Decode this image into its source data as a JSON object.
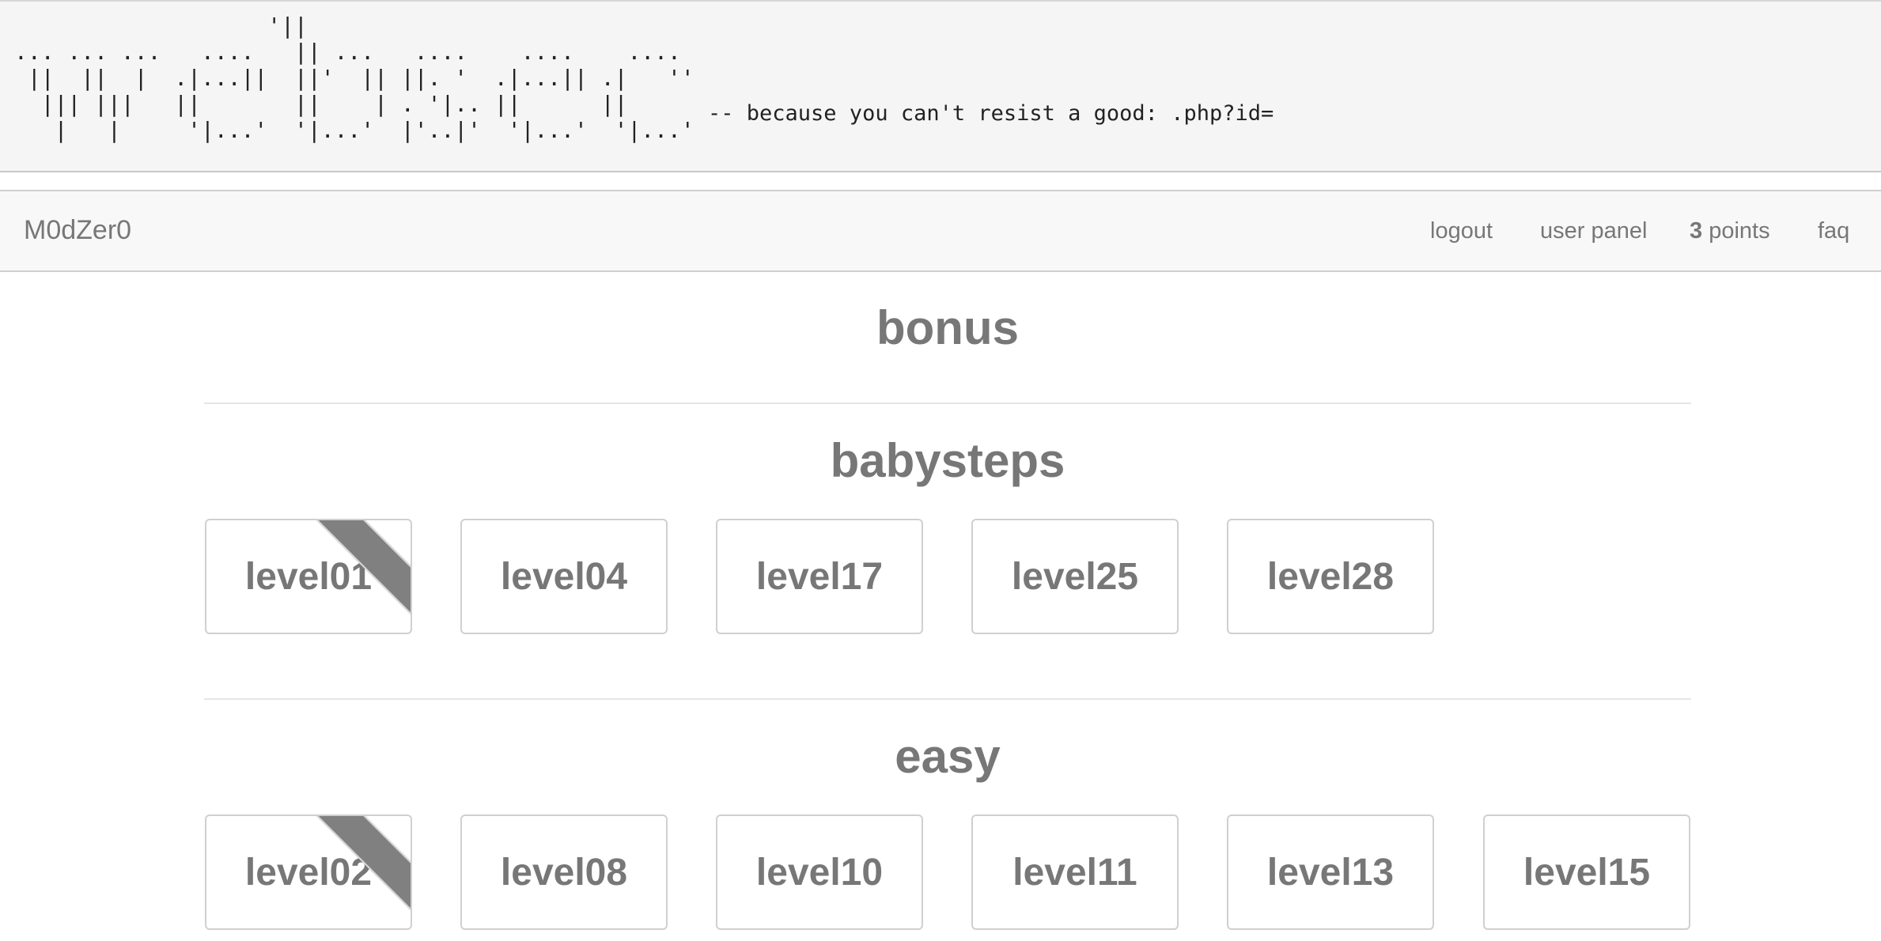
{
  "banner": {
    "ascii_art": "                   '||\n... ... ...   ....   || ...   ....    ....    ....\n ||  ||  |  .|...||  ||'  || ||. '  .|...|| .|   ''\n  ||| |||   ||       ||    | . '|.. ||      ||\n   |   |     '|...'  '|...'  |'..|'  '|...'  '|...'",
    "tagline": "-- because you can't resist a good: .php?id="
  },
  "nav": {
    "brand": "M0dZer0",
    "logout": "logout",
    "user_panel": "user panel",
    "points_value": "3",
    "points_label": " points",
    "faq": "faq"
  },
  "categories": {
    "bonus": {
      "title": "bonus"
    },
    "babysteps": {
      "title": "babysteps",
      "levels": [
        {
          "name": "level01",
          "solved": true
        },
        {
          "name": "level04",
          "solved": false
        },
        {
          "name": "level17",
          "solved": false
        },
        {
          "name": "level25",
          "solved": false
        },
        {
          "name": "level28",
          "solved": false
        }
      ]
    },
    "easy": {
      "title": "easy",
      "levels": [
        {
          "name": "level02",
          "solved": true
        },
        {
          "name": "level08",
          "solved": false
        },
        {
          "name": "level10",
          "solved": false
        },
        {
          "name": "level11",
          "solved": false
        },
        {
          "name": "level13",
          "solved": false
        },
        {
          "name": "level15",
          "solved": false
        }
      ]
    }
  },
  "colors": {
    "text": "#777777",
    "banner_bg": "#f5f5f5",
    "navbar_bg": "#f8f8f8",
    "ribbon": "#808080"
  }
}
